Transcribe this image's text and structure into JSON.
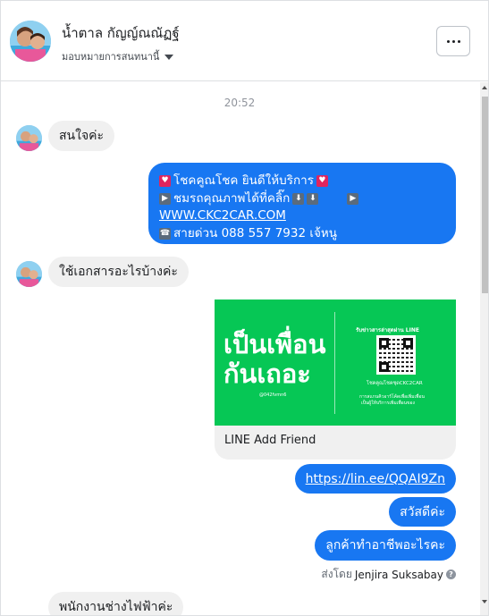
{
  "header": {
    "contact_name": "น้ำตาล กัญญ์ณณัฏฐ์",
    "assign_label": "มอบหมายการสนทนานี้",
    "avatar_icon": "profile-photo",
    "more_icon": "more-horizontal-icon"
  },
  "chat": {
    "timestamp": "20:52",
    "messages": [
      {
        "from": "customer",
        "text": "สนใจค่ะ"
      },
      {
        "from": "page",
        "lines": [
          {
            "prefix_icons": [
              "heart-emoji"
            ],
            "text": "โชคคูณโชค ยินดีให้บริการ",
            "suffix_icons": [
              "heart-emoji"
            ]
          },
          {
            "prefix_icons": [
              "play-emoji"
            ],
            "text": "ชมรถคุณภาพได้ที่คลิ๊ก",
            "suffix_icons": [
              "down-arrow-emoji",
              "down-arrow-emoji",
              "play-emoji"
            ]
          },
          {
            "text": "WWW.CKC2CAR.COM",
            "is_link": true
          },
          {
            "prefix_icons": [
              "phone-emoji"
            ],
            "text": "สายด่วน 088 557 7932 เจ้หนู"
          }
        ]
      },
      {
        "from": "customer",
        "text": "ใช้เอกสารอะไรบ้างค่ะ"
      },
      {
        "from": "page",
        "type": "card",
        "card": {
          "big_text_line1": "เป็นเพื่อน",
          "big_text_line2": "กันเถอะ",
          "line_id": "@042fvmn6",
          "qr_caption_top": "รับข่าวสารล่าสุดผ่าน LINE",
          "qr_caption_bottom": "โชคคูณโชคชุดCKC2CAR",
          "qr_fine_print_1": "การสแกนคิวอาร์โค้ดเพื่อเพิ่มเพื่อน",
          "qr_fine_print_2": "เป็นผู้ให้บริการเพิ่มเพื่อนของ",
          "label": "LINE Add Friend"
        }
      },
      {
        "from": "page",
        "text": "https://lin.ee/QQAI9Zn",
        "is_link": true
      },
      {
        "from": "page",
        "text": "สวัสดีค่ะ"
      },
      {
        "from": "page",
        "text": "ลูกค้าทำอาชีพอะไรคะ"
      },
      {
        "from": "customer",
        "text": "พนักงานช่างไฟฟ้าค่ะ"
      }
    ],
    "sent_by_label": "ส่งโดย",
    "sent_by_name": "Jenjira Suksabay"
  },
  "colors": {
    "outgoing_bubble": "#1877f2",
    "incoming_bubble": "#f0f0f0",
    "line_green": "#06c755"
  }
}
